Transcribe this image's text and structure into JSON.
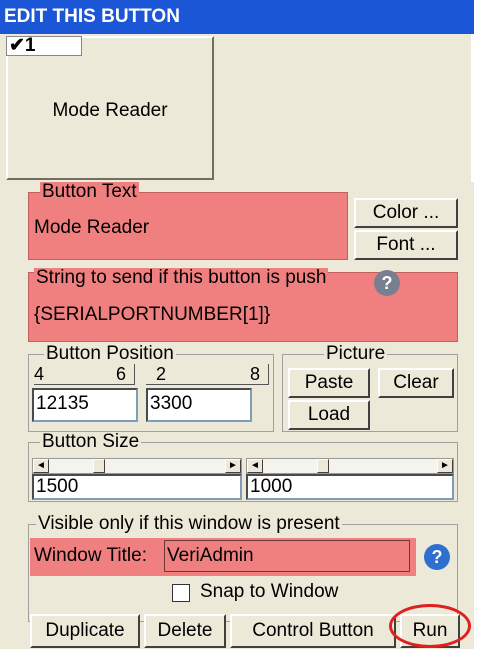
{
  "window": {
    "title": "EDIT THIS BUTTON"
  },
  "preview": {
    "checkbox_label": "1",
    "button_label": "Mode Reader"
  },
  "button_text": {
    "legend": "Button Text",
    "value": "Mode Reader",
    "color_label": "Color ...",
    "font_label": "Font ..."
  },
  "string_send": {
    "legend": "String to send if this button is push",
    "value": "{SERIALPORTNUMBER[1]}",
    "help_icon": "?"
  },
  "position": {
    "legend": "Button Position",
    "x_left": "4",
    "x_right": "6",
    "y_left": "2",
    "y_right": "8",
    "x_value": "12135",
    "y_value": "3300"
  },
  "picture": {
    "legend": "Picture",
    "paste_label": "Paste",
    "clear_label": "Clear",
    "load_label": "Load"
  },
  "size": {
    "legend": "Button Size",
    "width_value": "1500",
    "height_value": "1000"
  },
  "visible": {
    "legend": "Visible only if this window is present",
    "window_title_label": "Window Title:",
    "window_title_value": "VeriAdmin",
    "snap_label": "Snap to Window",
    "help_icon": "?"
  },
  "footer": {
    "duplicate_label": "Duplicate",
    "delete_label": "Delete",
    "control_label": "Control Button",
    "run_label": "Run"
  }
}
